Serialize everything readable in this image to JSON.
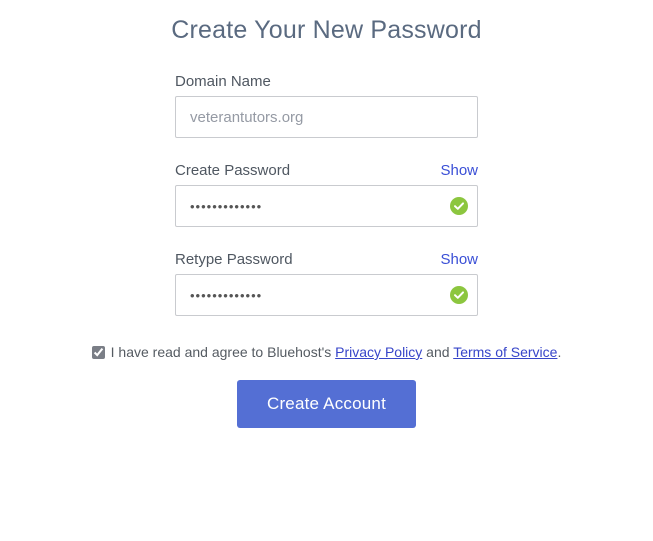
{
  "title": "Create Your New Password",
  "fields": {
    "domain": {
      "label": "Domain Name",
      "value": "veterantutors.org"
    },
    "password": {
      "label": "Create Password",
      "show": "Show",
      "value": "•••••••••••••"
    },
    "retype": {
      "label": "Retype Password",
      "show": "Show",
      "value": "•••••••••••••"
    }
  },
  "consent": {
    "checked": true,
    "prefix": "I have read and agree to Bluehost's ",
    "privacy": "Privacy Policy",
    "mid": " and ",
    "terms": "Terms of Service",
    "suffix": "."
  },
  "submit": "Create Account"
}
